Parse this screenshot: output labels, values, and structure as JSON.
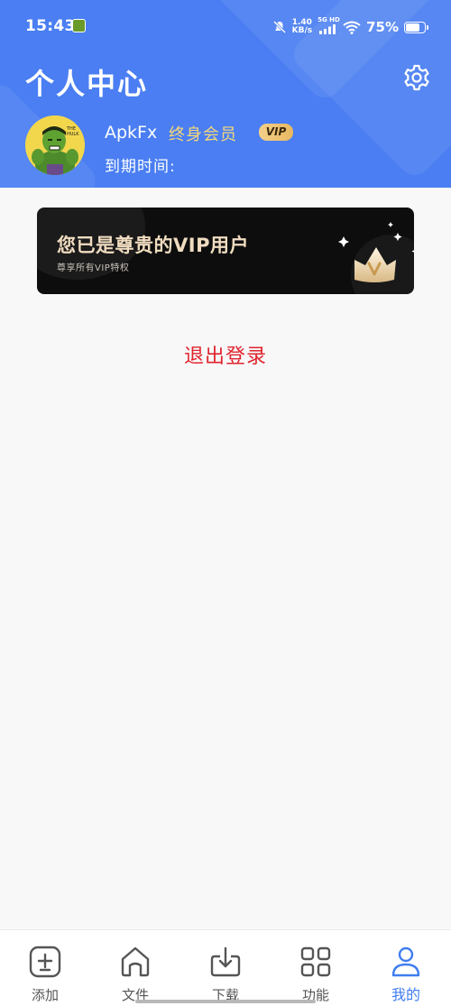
{
  "status_bar": {
    "time": "15:43",
    "net_speed_value": "1.40",
    "net_speed_unit": "KB/s",
    "net_type": "5G HD",
    "battery_percent": "75%",
    "battery_level": 0.75,
    "icons": [
      "app-notification-icon",
      "mute-icon",
      "signal-icon",
      "wifi-icon",
      "battery-icon"
    ]
  },
  "header": {
    "title": "个人中心",
    "settings_icon": "gear-icon",
    "background_color": "#4a7ef2"
  },
  "profile": {
    "username": "ApkFx",
    "member_type": "终身会员",
    "vip_badge": "VIP",
    "expiry_label": "到期时间:",
    "avatar_icon": "hulk-avatar"
  },
  "vip_banner": {
    "title": "您已是尊贵的VIP用户",
    "subtitle": "尊享所有VIP特权",
    "icon": "crown-icon"
  },
  "logout": {
    "label": "退出登录",
    "color": "#e0242e"
  },
  "bottom_nav": {
    "active_color": "#3f7df0",
    "items": [
      {
        "label": "添加",
        "icon": "add-square-icon",
        "active": false
      },
      {
        "label": "文件",
        "icon": "home-icon",
        "active": false
      },
      {
        "label": "下载",
        "icon": "download-icon",
        "active": false
      },
      {
        "label": "功能",
        "icon": "grid-icon",
        "active": false
      },
      {
        "label": "我的",
        "icon": "user-icon",
        "active": true
      }
    ]
  }
}
